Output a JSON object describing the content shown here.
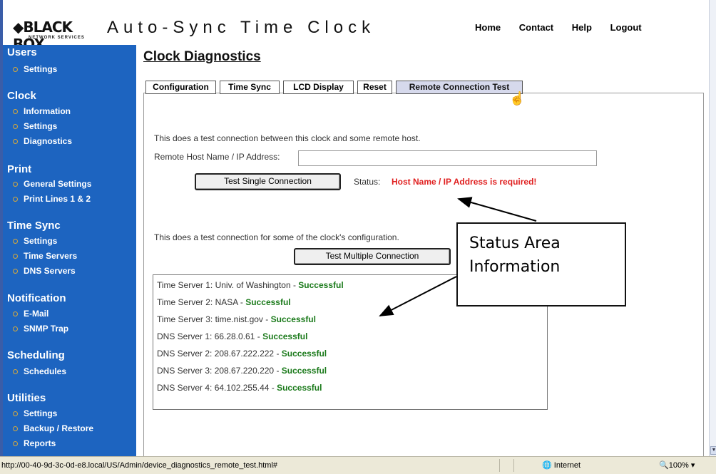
{
  "header": {
    "logo_text": "BLACK BOX",
    "logo_sub": "NETWORK SERVICES",
    "app_title": "Auto-Sync Time Clock",
    "nav": [
      "Home",
      "Contact",
      "Help",
      "Logout"
    ]
  },
  "sidebar": {
    "sections": [
      {
        "title": "Users",
        "items": [
          "Settings"
        ]
      },
      {
        "title": "Clock",
        "items": [
          "Information",
          "Settings",
          "Diagnostics"
        ]
      },
      {
        "title": "Print",
        "items": [
          "General Settings",
          "Print Lines 1 & 2"
        ]
      },
      {
        "title": "Time Sync",
        "items": [
          "Settings",
          "Time Servers",
          "DNS Servers"
        ]
      },
      {
        "title": "Notification",
        "items": [
          "E-Mail",
          "SNMP Trap"
        ]
      },
      {
        "title": "Scheduling",
        "items": [
          "Schedules"
        ]
      },
      {
        "title": "Utilities",
        "items": [
          "Settings",
          "Backup / Restore",
          "Reports"
        ]
      }
    ]
  },
  "page": {
    "title": "Clock Diagnostics",
    "tabs": [
      "Configuration",
      "Time Sync",
      "LCD Display",
      "Reset",
      "Remote Connection Test"
    ],
    "active_tab": "Remote Connection Test"
  },
  "single": {
    "desc": "This does a test connection between this clock and some remote host.",
    "host_label": "Remote Host Name / IP Address:",
    "host_value": "",
    "button": "Test Single Connection",
    "status_label": "Status:",
    "status_value": "Host Name / IP Address is required!"
  },
  "multiple": {
    "desc": "This does a test connection for some of the clock's configuration.",
    "button": "Test Multiple Connection",
    "results": [
      {
        "label": "Time Server 1: Univ. of Washington - ",
        "status": "Successful"
      },
      {
        "label": "Time Server 2: NASA - ",
        "status": "Successful"
      },
      {
        "label": "Time Server 3: time.nist.gov - ",
        "status": "Successful"
      },
      {
        "label": "DNS Server 1: 66.28.0.61 - ",
        "status": "Successful"
      },
      {
        "label": "DNS Server 2: 208.67.222.222 - ",
        "status": "Successful"
      },
      {
        "label": "DNS Server 3: 208.67.220.220 - ",
        "status": "Successful"
      },
      {
        "label": "DNS Server 4: 64.102.255.44 - ",
        "status": "Successful"
      }
    ]
  },
  "callout": {
    "line1": "Status Area",
    "line2": "Information"
  },
  "statusbar": {
    "url": "http://00-40-9d-3c-0d-e8.local/US/Admin/device_diagnostics_remote_test.html#",
    "zone": "Internet",
    "zoom": "100%"
  },
  "colors": {
    "sidebar": "#1d64c0",
    "error": "#e02020",
    "success": "#1b7a1b",
    "active_tab": "#d6d9ec"
  }
}
